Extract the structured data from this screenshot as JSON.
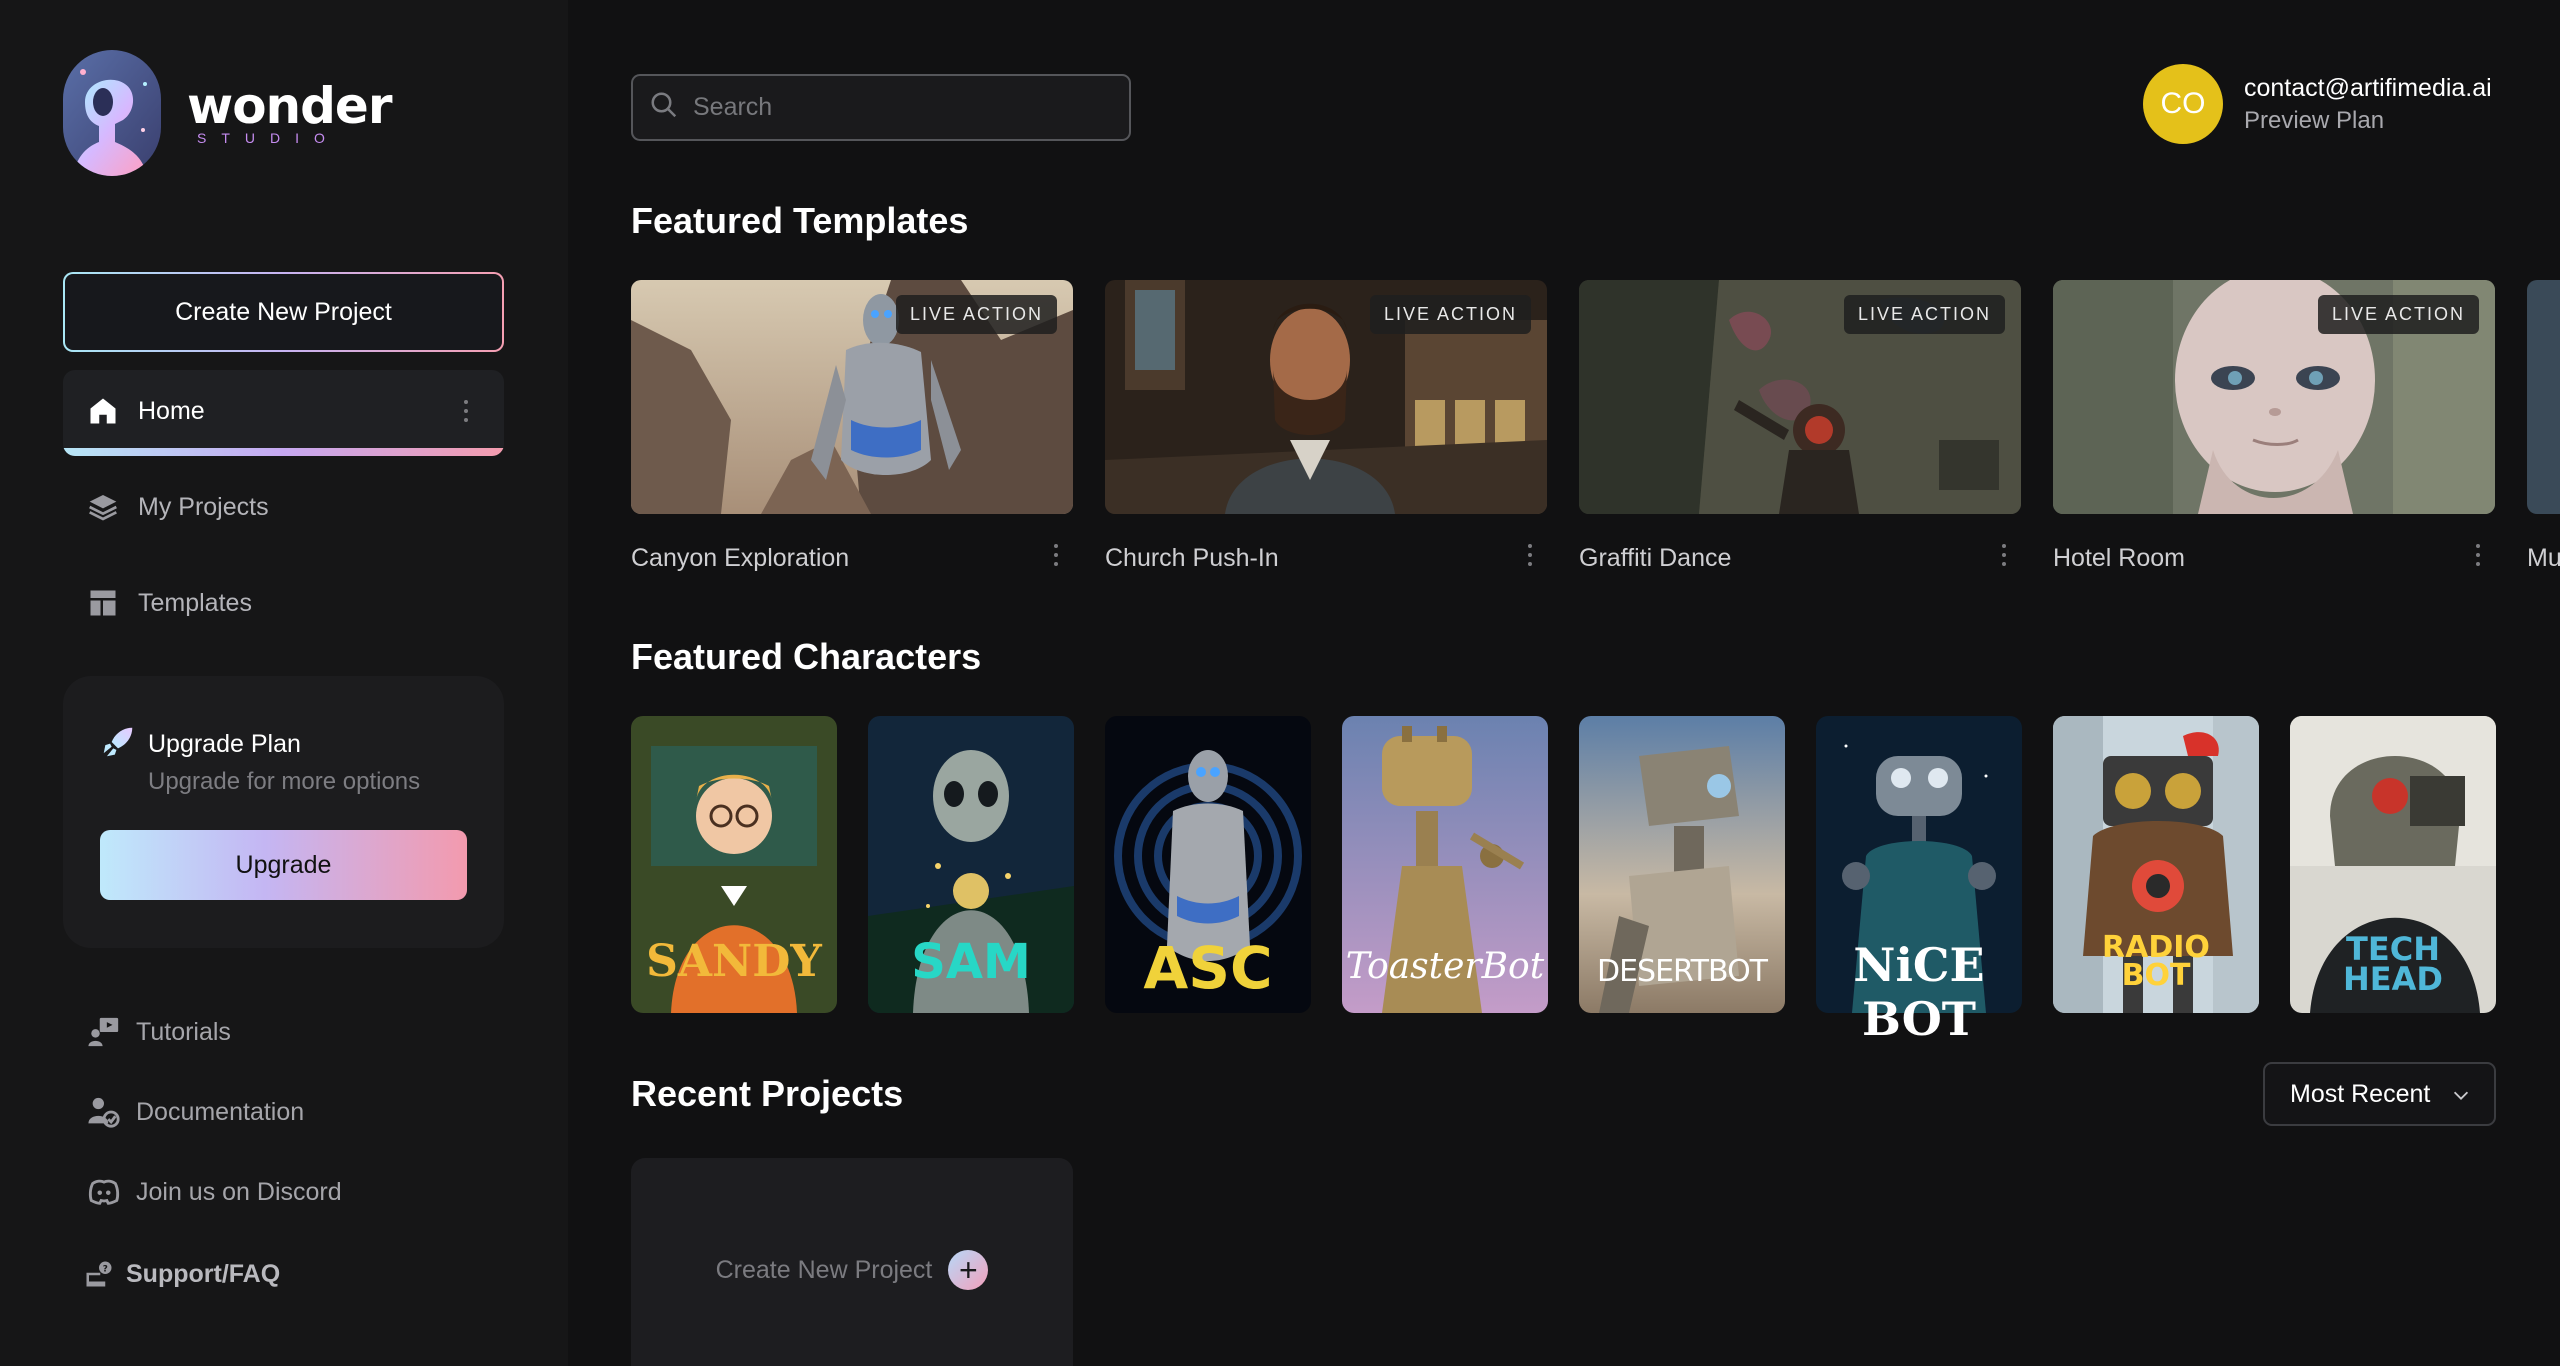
{
  "app": {
    "name": "wonder",
    "sub": "STUDIO"
  },
  "sidebar": {
    "create_label": "Create New Project",
    "nav": [
      {
        "label": "Home",
        "icon": "home-icon",
        "active": true
      },
      {
        "label": "My Projects",
        "icon": "layers-icon"
      },
      {
        "label": "Templates",
        "icon": "templates-icon"
      }
    ],
    "upgrade": {
      "title": "Upgrade Plan",
      "subtitle": "Upgrade for more options",
      "button": "Upgrade"
    },
    "links": [
      {
        "label": "Tutorials",
        "icon": "tutorials-icon"
      },
      {
        "label": "Documentation",
        "icon": "documentation-icon"
      },
      {
        "label": "Join us on Discord",
        "icon": "discord-icon"
      },
      {
        "label": "Support/FAQ",
        "icon": "support-icon"
      }
    ]
  },
  "search": {
    "placeholder": "Search"
  },
  "user": {
    "initials": "CO",
    "email": "contact@artifimedia.ai",
    "plan": "Preview Plan"
  },
  "featured_templates": {
    "title": "Featured Templates",
    "items": [
      {
        "name": "Canyon Exploration",
        "badge": "LIVE ACTION"
      },
      {
        "name": "Church Push-In",
        "badge": "LIVE ACTION"
      },
      {
        "name": "Graffiti Dance",
        "badge": "LIVE ACTION"
      },
      {
        "name": "Hotel Room",
        "badge": "LIVE ACTION"
      },
      {
        "name": "Mu"
      }
    ]
  },
  "featured_characters": {
    "title": "Featured Characters",
    "items": [
      {
        "name": "SANDY",
        "color": "#f2b93a"
      },
      {
        "name": "SAM",
        "color": "#27d7c6"
      },
      {
        "name": "ASC",
        "color": "#f0d23a"
      },
      {
        "name": "ToasterBot",
        "color": "#ffffff"
      },
      {
        "name": "DESERTBOT",
        "color": "#ffffff"
      },
      {
        "name": "NiCE BOT",
        "color": "#ffffff"
      },
      {
        "name": "RADIO BOT",
        "color": "#ffd23a"
      },
      {
        "name": "TECH HEAD",
        "color": "#4fb7d8"
      }
    ]
  },
  "recent_projects": {
    "title": "Recent Projects",
    "sort": "Most Recent",
    "new_label": "Create New Project"
  }
}
